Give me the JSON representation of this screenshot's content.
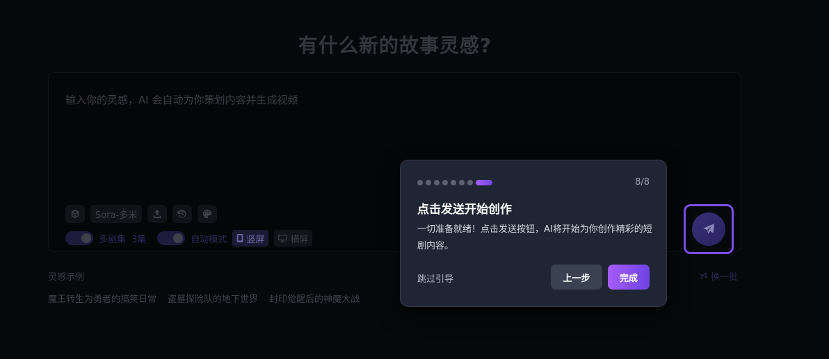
{
  "header": {
    "title": "有什么新的故事灵感?"
  },
  "composer": {
    "placeholder": "输入你的灵感，AI 会自动为你策划内容并生成视频",
    "tools": {
      "model_label": "Sora-多米"
    },
    "options": {
      "multi_episode_label": "多剧集",
      "episode_count": "3集",
      "auto_mode_label": "自动模式",
      "portrait_label": "竖屏",
      "landscape_label": "横屏"
    }
  },
  "examples": {
    "title": "灵感示例",
    "shuffle_label": "换一批",
    "items": [
      "魔王转生为勇者的搞笑日常",
      "盗墓探险队的地下世界",
      "封印觉醒后的神魔大战"
    ]
  },
  "tour": {
    "step": "8/8",
    "total_dots": 8,
    "active_dot": 8,
    "title": "点击发送开始创作",
    "body": "一切准备就绪！点击发送按钮，AI将开始为你创作精彩的短剧内容。",
    "skip_label": "跳过引导",
    "prev_label": "上一步",
    "done_label": "完成"
  },
  "colors": {
    "accent": "#7c4de8",
    "popover_bg": "#1f2533",
    "page_bg": "#07080b"
  },
  "icons": [
    "cube-icon",
    "upload-icon",
    "history-icon",
    "palette-icon",
    "phone-icon",
    "monitor-icon",
    "send-icon",
    "shuffle-icon"
  ]
}
